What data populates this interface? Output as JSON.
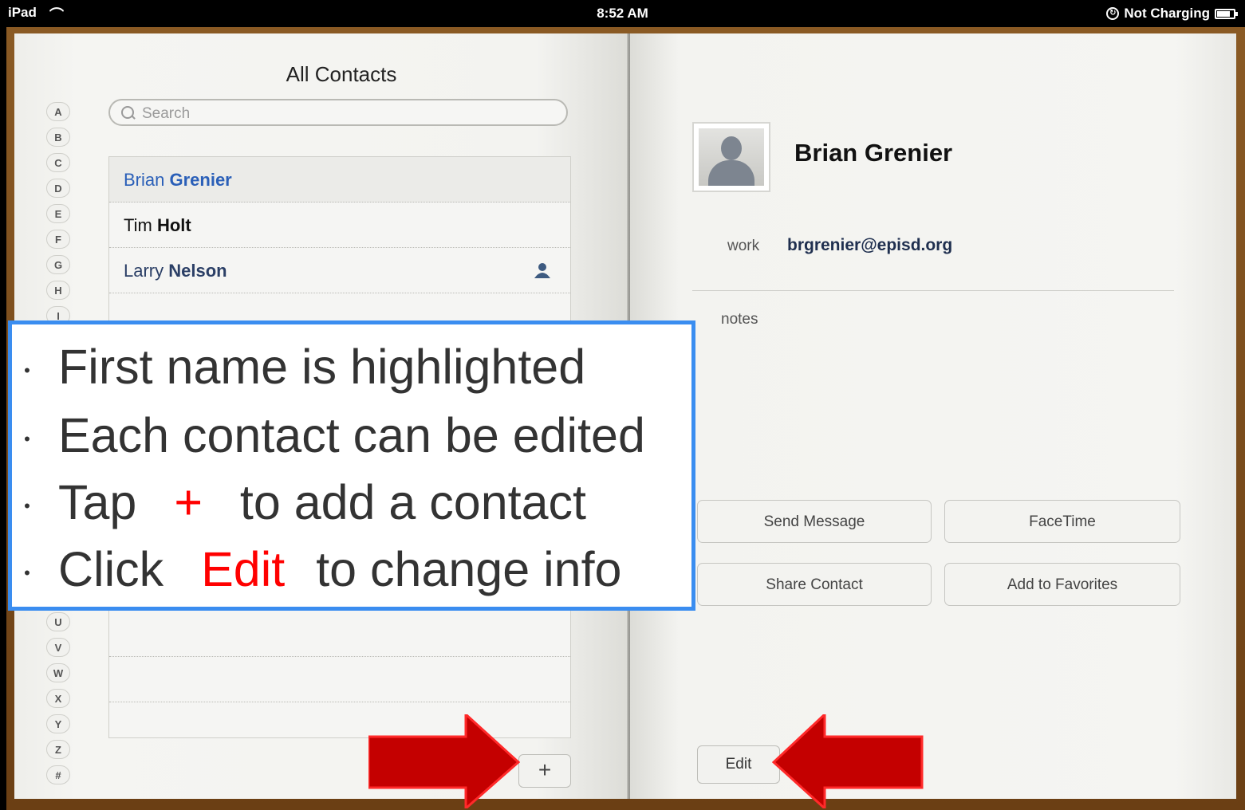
{
  "status_bar": {
    "device": "iPad",
    "time": "8:52 AM",
    "charging": "Not Charging"
  },
  "contacts": {
    "title": "All Contacts",
    "search_placeholder": "Search",
    "index_letters": [
      "A",
      "B",
      "C",
      "D",
      "E",
      "F",
      "G",
      "H",
      "I",
      "U",
      "V",
      "W",
      "X",
      "Y",
      "Z",
      "#"
    ],
    "list": [
      {
        "first": "Brian",
        "last": "Grenier",
        "selected": true
      },
      {
        "first": "Tim",
        "last": "Holt",
        "selected": false
      },
      {
        "first": "Larry",
        "last": "Nelson",
        "selected": false,
        "icon": "person-icon"
      }
    ],
    "add_label": "+"
  },
  "detail": {
    "name": "Brian Grenier",
    "email_label": "work",
    "email": "brgrenier@episd.org",
    "notes_label": "notes",
    "buttons": {
      "send_message": "Send Message",
      "facetime": "FaceTime",
      "share_contact": "Share Contact",
      "add_favorites": "Add to Favorites"
    },
    "edit_label": "Edit"
  },
  "callout": {
    "line1": "First name is highlighted",
    "line2": "Each contact can be edited",
    "line3_pre": "Tap",
    "line3_plus": "+",
    "line3_post": "to add a contact",
    "line4_pre": "Click",
    "line4_edit": "Edit",
    "line4_post": "to change info"
  },
  "colors": {
    "accent_blue": "#3a8df0",
    "highlight_red": "#ff0000",
    "arrow_red": "#c40000"
  }
}
